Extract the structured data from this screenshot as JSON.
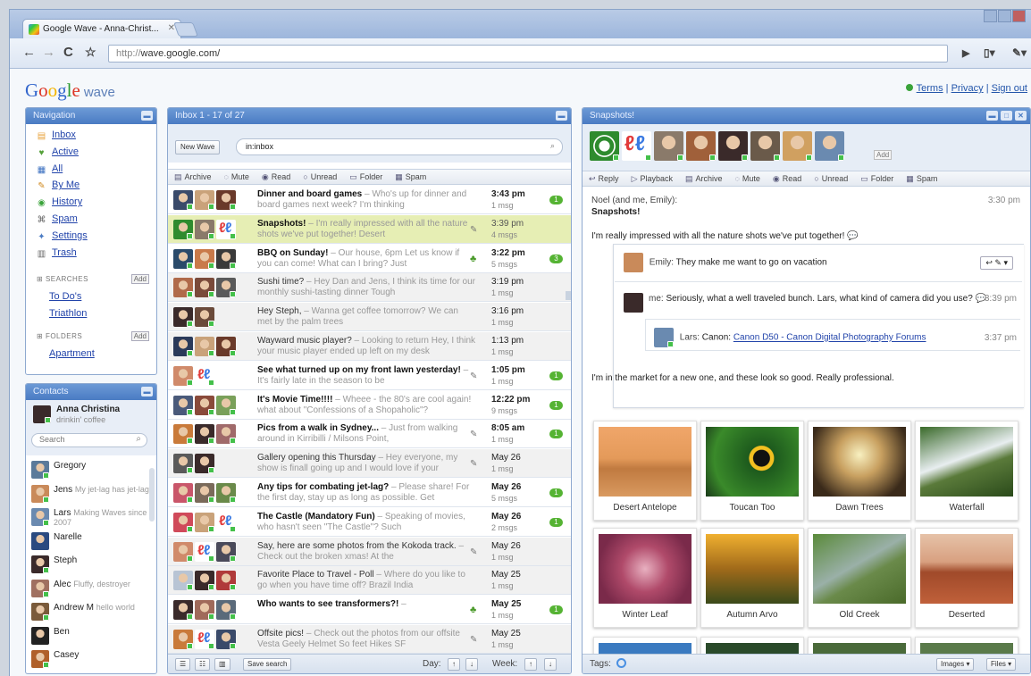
{
  "browser": {
    "tab_title": "Google Wave - Anna-Christ...",
    "url_scheme": "http://",
    "url_rest": "wave.google.com/"
  },
  "header": {
    "logo_google": [
      "G",
      "o",
      "o",
      "g",
      "l",
      "e"
    ],
    "logo_wave": "wave",
    "links": [
      "Terms",
      "Privacy",
      "Sign out"
    ]
  },
  "navigation": {
    "title": "Navigation",
    "items": [
      {
        "label": "Inbox",
        "icon": "inbox-icon",
        "glyph": "▤",
        "color": "#e8a13a"
      },
      {
        "label": "Active",
        "icon": "active-icon",
        "glyph": "♥",
        "color": "#55a13a"
      },
      {
        "label": "All",
        "icon": "all-icon",
        "glyph": "▦",
        "color": "#3a6fc0"
      },
      {
        "label": "By Me",
        "icon": "pencil-icon",
        "glyph": "✎",
        "color": "#d08a20"
      },
      {
        "label": "History",
        "icon": "history-icon",
        "glyph": "◉",
        "color": "#3aa33a"
      },
      {
        "label": "Spam",
        "icon": "spam-icon",
        "glyph": "⌘",
        "color": "#666"
      },
      {
        "label": "Settings",
        "icon": "settings-icon",
        "glyph": "✦",
        "color": "#4a7bc3"
      },
      {
        "label": "Trash",
        "icon": "trash-icon",
        "glyph": "▥",
        "color": "#666"
      }
    ],
    "searches_label": "SEARCHES",
    "searches": [
      "To Do's",
      "Triathlon"
    ],
    "folders_label": "FOLDERS",
    "folders": [
      "Apartment"
    ],
    "add_label": "Add"
  },
  "contacts": {
    "title": "Contacts",
    "me_name": "Anna Christina",
    "me_status": "drinkin' coffee",
    "search_placeholder": "Search",
    "list": [
      {
        "name": "Gregory",
        "status": "",
        "color": "#5a7a9a",
        "online": true
      },
      {
        "name": "Jens",
        "status": "My jet-lag has jet-lag",
        "color": "#c98a5a",
        "online": true
      },
      {
        "name": "Lars",
        "status": "Making Waves since 2007",
        "color": "#6a8ab0",
        "online": true
      },
      {
        "name": "Narelle",
        "status": "",
        "color": "#2a4a80",
        "online": false
      },
      {
        "name": "Steph",
        "status": "",
        "color": "#3a2a2a",
        "online": true
      },
      {
        "name": "Alec",
        "status": "Fluffy, destroyer",
        "color": "#a07060",
        "online": true
      },
      {
        "name": "Andrew M",
        "status": "hello world",
        "color": "#7a5a3a",
        "online": true
      },
      {
        "name": "Ben",
        "status": "",
        "color": "#222",
        "online": false
      },
      {
        "name": "Casey",
        "status": "",
        "color": "#b0602a",
        "online": true
      }
    ]
  },
  "inbox": {
    "title": "Inbox 1 - 17 of 27",
    "new_wave": "New Wave",
    "search_value": "in:inbox",
    "actions": [
      "Archive",
      "Mute",
      "Read",
      "Unread",
      "Folder",
      "Spam"
    ],
    "rows": [
      {
        "title": "Dinner and board games",
        "snippet": "Who's up for dinner and board games next week? I'm thinking",
        "time": "3:43 pm",
        "msgs": "1 msg",
        "unread": "1",
        "state": "unread",
        "mark": "",
        "avs": [
          "#3a4a6a",
          "#c9a27a",
          "#6a3a2a"
        ]
      },
      {
        "title": "Snapshots!",
        "snippet": "I'm really impressed with all the nature shots we've put together! Desert",
        "time": "3:39 pm",
        "msgs": "4 msgs",
        "unread": "",
        "state": "sel",
        "mark": "clip",
        "avs": [
          "#2e8b2e",
          "#8a7a6a",
          "wave"
        ]
      },
      {
        "title": "BBQ on Sunday!",
        "snippet": "Our house, 6pm Let us know if you can come! What can I bring? Just",
        "time": "3:22 pm",
        "msgs": "5 msgs",
        "unread": "3",
        "state": "unread",
        "mark": "star",
        "avs": [
          "#2a4a6a",
          "#c97a4a",
          "#3a3a3a"
        ]
      },
      {
        "title": "Sushi time?",
        "snippet": "Hey Dan and Jens, I think its time for our monthly sushi-tasting dinner Tough",
        "time": "3:19 pm",
        "msgs": "1 msg",
        "unread": "",
        "state": "read",
        "mark": "",
        "avs": [
          "#b06a4a",
          "#7a4a3a",
          "#5a5a5a"
        ]
      },
      {
        "title": "Hey Steph,",
        "snippet": "Wanna get coffee tomorrow? We can met by the palm trees",
        "time": "3:16 pm",
        "msgs": "1 msg",
        "unread": "",
        "state": "read",
        "mark": "",
        "avs": [
          "#3a2a2a",
          "#6a4a3a"
        ]
      },
      {
        "title": "Wayward music player?",
        "snippet": "Looking to return Hey, I think your music player ended up left on my desk",
        "time": "1:13 pm",
        "msgs": "1 msg",
        "unread": "",
        "state": "read",
        "mark": "",
        "avs": [
          "#2a3a5a",
          "#c9a27a",
          "#6a3a2a"
        ]
      },
      {
        "title": "See what turned up on my front lawn yesterday!",
        "snippet": "It's fairly late in the season to be",
        "time": "1:05 pm",
        "msgs": "1 msg",
        "unread": "1",
        "state": "unread",
        "mark": "clip",
        "avs": [
          "#d08a6a",
          "wave"
        ]
      },
      {
        "title": "It's Movie Time!!!!",
        "snippet": "Wheee - the 80's are cool again! what about \"Confessions of a Shopaholic\"?",
        "time": "12:22 pm",
        "msgs": "9 msgs",
        "unread": "1",
        "state": "unread",
        "mark": "",
        "avs": [
          "#4a5a7a",
          "#8a4a3a",
          "#7aa05a"
        ]
      },
      {
        "title": "Pics from a walk in Sydney...",
        "snippet": "Just from walking around in Kirribilli / Milsons Point,",
        "time": "8:05 am",
        "msgs": "1 msg",
        "unread": "1",
        "state": "unread",
        "mark": "clip",
        "avs": [
          "#c97a3a",
          "#3a2a2a",
          "#a06a6a"
        ]
      },
      {
        "title": "Gallery opening this Thursday",
        "snippet": "Hey everyone, my show is finall going up and I would love if your",
        "time": "May 26",
        "msgs": "1 msg",
        "unread": "",
        "state": "read",
        "mark": "clip",
        "avs": [
          "#5a5a5a",
          "#3a2a2a"
        ]
      },
      {
        "title": "Any tips for combating jet-lag?",
        "snippet": "Please share! For the first day, stay up as long as possible. Get",
        "time": "May 26",
        "msgs": "5 msgs",
        "unread": "1",
        "state": "unread",
        "mark": "",
        "avs": [
          "#c9566a",
          "#7a6a5a",
          "#6a8a4a"
        ]
      },
      {
        "title": "The Castle (Mandatory Fun)",
        "snippet": "Speaking of movies, who hasn't seen \"The Castle\"? Such",
        "time": "May 26",
        "msgs": "2 msgs",
        "unread": "1",
        "state": "unread",
        "mark": "",
        "avs": [
          "#d04a5a",
          "#c9a27a",
          "wave"
        ]
      },
      {
        "title": "Say, here are some photos from the Kokoda track.",
        "snippet": "Check out the broken xmas! At the",
        "time": "May 26",
        "msgs": "1 msg",
        "unread": "",
        "state": "read",
        "mark": "clip",
        "avs": [
          "#d08a6a",
          "wave",
          "#4a4a5a"
        ]
      },
      {
        "title": "Favorite Place to Travel - Poll",
        "snippet": "Where do you like to go when you have time off? Brazil India",
        "time": "May 25",
        "msgs": "1 msg",
        "unread": "",
        "state": "read",
        "mark": "",
        "avs": [
          "#b8c4d4",
          "#3a2a2a",
          "#b03a3a"
        ]
      },
      {
        "title": "Who wants to see transformers?!",
        "snippet": "",
        "time": "May 25",
        "msgs": "1 msg",
        "unread": "1",
        "state": "unread",
        "mark": "star",
        "avs": [
          "#3a2a2a",
          "#a06a5a",
          "#5a6a7a"
        ]
      },
      {
        "title": "Offsite pics!",
        "snippet": "Check out the photos from our offsite Vesta Geely Helmet So feet Hikes SF",
        "time": "May 25",
        "msgs": "1 msg",
        "unread": "",
        "state": "read",
        "mark": "clip",
        "avs": [
          "#c97a3a",
          "wave",
          "#3a4a6a"
        ]
      }
    ],
    "footer": {
      "save_search": "Save search",
      "day": "Day:",
      "week": "Week:"
    }
  },
  "wave": {
    "title": "Snapshots!",
    "participants": [
      "#2e8b2e",
      "wave",
      "#8a7a6a",
      "#a0603a",
      "#3a2a2a",
      "#6a5a4a",
      "#d0a060",
      "#6a8ab0"
    ],
    "participants_add": "Add",
    "actions": [
      "Reply",
      "Playback",
      "Archive",
      "Mute",
      "Read",
      "Unread",
      "Folder",
      "Spam"
    ],
    "root": {
      "authors": "Noel (and me, Emily):",
      "time": "3:30 pm",
      "title": "Snapshots!",
      "text": "I'm really impressed with all the nature shots we've put together!"
    },
    "reply1": {
      "author": "Emily:",
      "text": "They make me want to go on vacation"
    },
    "reply2": {
      "author": "me:",
      "text": "Seriously, what a well traveled bunch. Lars, what kind of camera did you use?",
      "time": "3:39 pm"
    },
    "reply3": {
      "author": "Lars:",
      "text": "Canon:",
      "link": "Canon D50 - Canon Digital Photography Forums",
      "time": "3:37 pm"
    },
    "reply4": {
      "text": "I'm in the market for a new one, and these look so good. Really professional."
    },
    "photos": [
      {
        "caption": "Desert Antelope",
        "grad": "linear-gradient(#f0a66a 0%,#e49a5a 45%,#c07a40 60%,#d99a60 100%)"
      },
      {
        "caption": "Toucan Too",
        "grad": "radial-gradient(circle at 60% 45%,#111 0 12%,#f3c020 13% 18%,#1d5a1d 19%,#3a8a2a 70%,#1a3a1a)"
      },
      {
        "caption": "Dawn Trees",
        "grad": "radial-gradient(circle at 50% 40%,#f8f0c0,#c8a060 35%,#3a2a1a 80%)"
      },
      {
        "caption": "Waterfall",
        "grad": "linear-gradient(160deg,#3a6a2a,#e8eef0 45%,#5a7a3a 60%,#2a4a1a)"
      },
      {
        "caption": "Winter Leaf",
        "grad": "radial-gradient(circle at 50% 50%,#e8b0c0,#b04a6a 40%,#7a2a4a 80%)"
      },
      {
        "caption": "Autumn Arvo",
        "grad": "linear-gradient(#f0b030,#a06a1a 50%,#3a4a1a)"
      },
      {
        "caption": "Old Creek",
        "grad": "linear-gradient(150deg,#5a8a3a,#9ab0a8 45%,#6a8a4a 60%,#4a6a2a)"
      },
      {
        "caption": "Deserted",
        "grad": "linear-gradient(#e6c2a8 0%,#d8a080 40%,#a04a2a 55%,#c0603a 100%)"
      }
    ],
    "tags_label": "Tags:",
    "images_btn": "Images",
    "files_btn": "Files"
  }
}
